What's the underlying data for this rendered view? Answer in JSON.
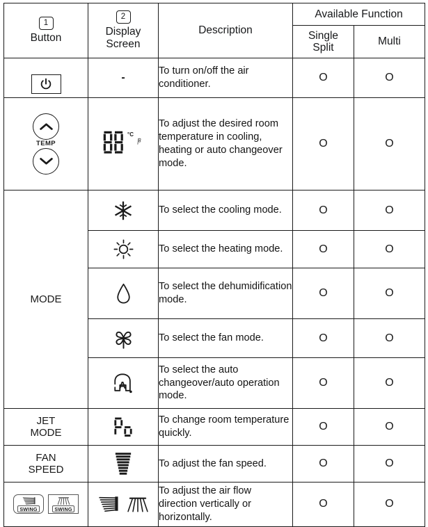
{
  "table": {
    "headers": {
      "button": {
        "badge": "1",
        "label": "Button"
      },
      "display": {
        "badge": "2",
        "label": "Display\nScreen"
      },
      "description": "Description",
      "available_function": "Available Function",
      "single_split": "Single\nSplit",
      "multi": "Multi"
    },
    "marks": {
      "yes": "O"
    },
    "rows": [
      {
        "button": {
          "type": "power-button",
          "label": ""
        },
        "display": {
          "type": "text",
          "value": "-"
        },
        "description": "To turn on/off the air conditioner.",
        "single_split": "O",
        "multi": "O"
      },
      {
        "button": {
          "type": "temp-updown-buttons",
          "label": "TEMP"
        },
        "display": {
          "type": "seven-segment-temperature",
          "value": "88",
          "unit": "°C"
        },
        "description": "To adjust the desired room temperature in cooling, heating or auto changeover mode.",
        "single_split": "O",
        "multi": "O"
      },
      {
        "button": {
          "type": "group-label",
          "label": "MODE"
        },
        "display": {
          "type": "snowflake-icon"
        },
        "description": "To select the cooling mode.",
        "single_split": "O",
        "multi": "O"
      },
      {
        "button": null,
        "display": {
          "type": "sun-icon"
        },
        "description": "To select the heating mode.",
        "single_split": "O",
        "multi": "O"
      },
      {
        "button": null,
        "display": {
          "type": "water-drop-icon"
        },
        "description": "To select the dehumidification mode.",
        "single_split": "O",
        "multi": "O"
      },
      {
        "button": null,
        "display": {
          "type": "fan-blade-icon"
        },
        "description": "To select the fan mode.",
        "single_split": "O",
        "multi": "O"
      },
      {
        "button": null,
        "display": {
          "type": "auto-a-icon",
          "value": "A"
        },
        "description": "To select the auto changeover/auto operation mode.",
        "single_split": "O",
        "multi": "O"
      },
      {
        "button": {
          "type": "group-label",
          "label": "JET\nMODE"
        },
        "display": {
          "type": "seven-segment-text",
          "value": "Po"
        },
        "description": "To change room temperature quickly.",
        "single_split": "O",
        "multi": "O"
      },
      {
        "button": {
          "type": "group-label",
          "label": "FAN\nSPEED"
        },
        "display": {
          "type": "fan-speed-bars-icon"
        },
        "description": "To adjust the fan speed.",
        "single_split": "O",
        "multi": "O"
      },
      {
        "button": {
          "type": "swing-buttons",
          "vertical_label": "SWING",
          "horizontal_label": "SWING"
        },
        "display": {
          "type": "airflow-direction-icons"
        },
        "description": "To adjust the air flow direction vertically or horizontally.",
        "single_split": "O",
        "multi": "O"
      }
    ]
  },
  "colors": {
    "ink": "#1a1a1a",
    "paper": "#ffffff",
    "rule": "#1a1a1a"
  }
}
